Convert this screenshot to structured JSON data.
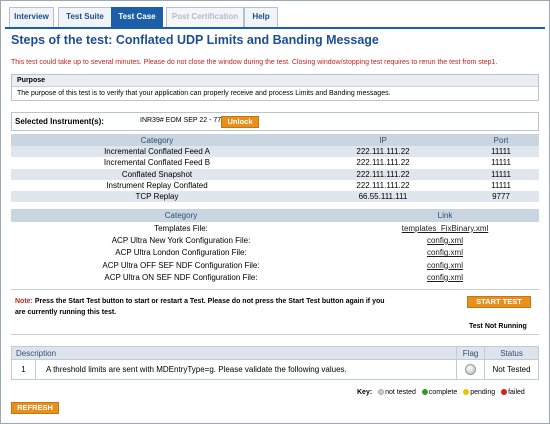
{
  "tabs": [
    {
      "label": "Interview",
      "state": "normal"
    },
    {
      "label": "Test Suite",
      "state": "normal"
    },
    {
      "label": "Test Case",
      "state": "active"
    },
    {
      "label": "Post Certification",
      "state": "disabled"
    },
    {
      "label": "Help",
      "state": "normal"
    }
  ],
  "page_title": "Steps of the test: Conflated UDP Limits and Banding Message",
  "warning": "This test could take up to several minutes. Please do not close the window during the test. Closing window/stopping test requires to rerun the test from step1.",
  "purpose": {
    "heading": "Purpose",
    "text": "The purpose of this test is to verify that your application can properly receive and process Limits and Banding messages."
  },
  "instrument": {
    "label": "Selected Instrument(s):",
    "value": "INR39# EOM SEP 22 - 771",
    "unlock_label": "Unlock"
  },
  "feeds": {
    "headers": [
      "Category",
      "IP",
      "Port"
    ],
    "rows": [
      [
        "Incremental Conflated Feed A",
        "222.111.111.22",
        "11111"
      ],
      [
        "Incremental Conflated Feed B",
        "222.111.111.22",
        "11111"
      ],
      [
        "Conflated Snapshot",
        "222.111.111.22",
        "11111"
      ],
      [
        "Instrument Replay Conflated",
        "222.111.111.22",
        "11111"
      ],
      [
        "TCP Replay",
        "66.55.111.111",
        "9777"
      ]
    ]
  },
  "files": {
    "headers": [
      "Category",
      "Link"
    ],
    "rows": [
      [
        "Templates File:",
        "templates_FixBinary.xml"
      ],
      [
        "ACP Ultra New York Configuration File:",
        "config.xml"
      ],
      [
        "ACP Ultra London Configuration File:",
        "config.xml"
      ],
      [
        "ACP Ultra OFF SEF NDF Configuration File:",
        "config.xml"
      ],
      [
        "ACP Ultra ON SEF NDF Configuration File:",
        "config.xml"
      ]
    ]
  },
  "note": {
    "prefix": "Note:",
    "text": " Press the Start Test button to start or restart a Test. Please do not press the Start Test button again if you are currently running this test.",
    "start_label": "START TEST",
    "status": "Test Not Running"
  },
  "results": {
    "headers": [
      "Description",
      "Flag",
      "Status"
    ],
    "rows": [
      {
        "num": "1",
        "description": "A threshold limits are sent with MDEntryType=g. Please validate the following values.",
        "flag_icon": "flag-grey-icon",
        "status": "Not Tested"
      }
    ]
  },
  "key": {
    "label": "Key:",
    "items": [
      {
        "label": "not tested",
        "color": "#c9c9c9"
      },
      {
        "label": "complete",
        "color": "#2e9b2e"
      },
      {
        "label": "pending",
        "color": "#e9c400"
      },
      {
        "label": "failed",
        "color": "#d42020"
      }
    ]
  },
  "refresh_label": "REFRESH"
}
